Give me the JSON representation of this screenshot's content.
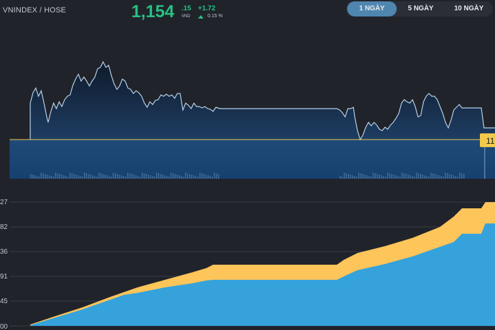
{
  "header": {
    "index_name": "VNINDEX / HOSE",
    "price_main": "1,154",
    "price_decimal": ".15",
    "price_unit": "VND",
    "change_abs": "+1.72",
    "change_pct": "0.15 %"
  },
  "tabs": [
    {
      "label": "1 NGÀY",
      "active": true
    },
    {
      "label": "5 NGÀY",
      "active": false
    },
    {
      "label": "10 NGÀY",
      "active": false
    }
  ],
  "price_chart": {
    "reference_tag": "11"
  },
  "volume_chart": {
    "y_tick_labels": [
      "27",
      "82",
      "36",
      "91",
      "45",
      "00"
    ]
  },
  "colors": {
    "background": "#21232b",
    "up": "#26c281",
    "price_line": "#b7d3ea",
    "reference_line": "#f2c94c",
    "volume_top": "#fdc55a",
    "volume_bottom": "#35a2dc",
    "tab_active": "#4f86b0"
  }
}
